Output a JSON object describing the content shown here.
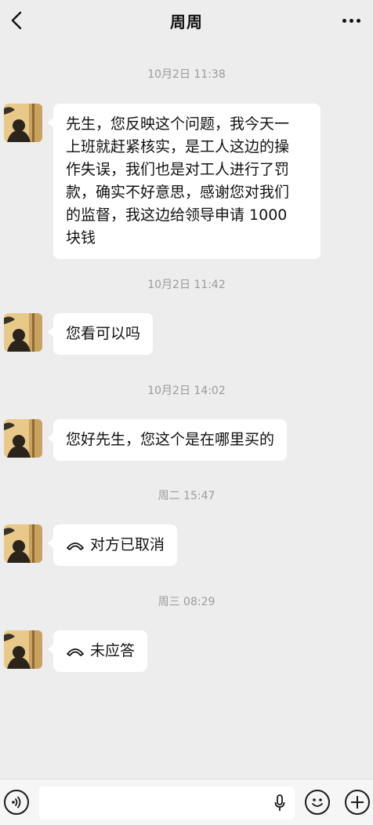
{
  "header": {
    "title": "周周",
    "back_icon": "chevron-left-icon",
    "more_icon": "more-dots-icon"
  },
  "messages": [
    {
      "timestamp": "10月2日 11:38",
      "text_lines": [
        "先生，您反映这个问题，我今天一",
        "上班就赶紧核实，是工人这边的操",
        "作失误，我们也是对工人进行了罚",
        "款，确实不好意思，感谢您对我们",
        "的监督，我这边给领导申请 1000",
        "块钱"
      ]
    },
    {
      "timestamp": "10月2日 11:42",
      "text": "您看可以吗"
    },
    {
      "timestamp": "10月2日 14:02",
      "text": "您好先生，您这个是在哪里买的"
    },
    {
      "timestamp": "周二 15:47",
      "text": "对方已取消",
      "icon": "phone-hangup-icon"
    },
    {
      "timestamp": "周三 08:29",
      "text": "未应答",
      "icon": "phone-hangup-icon"
    }
  ],
  "input_bar": {
    "voice_icon": "voice-icon",
    "mic_icon": "mic-icon",
    "emoji_icon": "emoji-icon",
    "plus_icon": "plus-icon"
  },
  "colors": {
    "background": "#ededed",
    "bubble": "#ffffff",
    "timestamp": "#9b9b9b"
  }
}
